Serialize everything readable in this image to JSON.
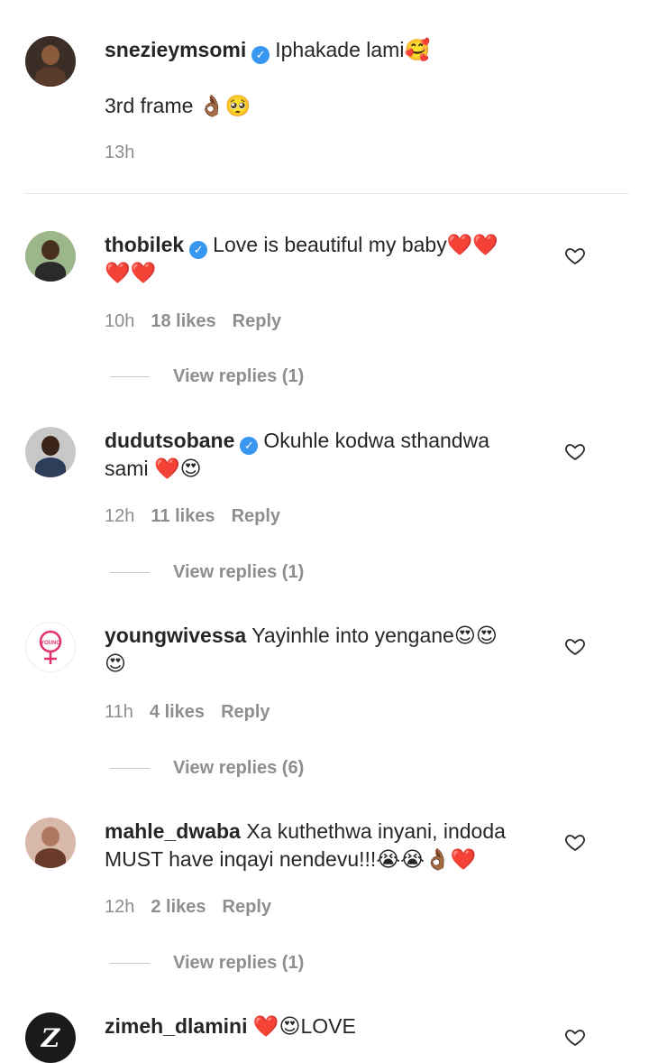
{
  "comments": [
    {
      "username": "snezieymsomi",
      "verified": true,
      "text": "Iphakade lami🥰",
      "text2": "3rd frame 👌🏾🥺",
      "time": "13h",
      "avatar_color": "#3a2e27"
    },
    {
      "username": "thobilek",
      "verified": true,
      "text": "Love is beautiful my baby❤️❤️",
      "text2": "❤️❤️",
      "time": "10h",
      "likes": "18 likes",
      "reply": "Reply",
      "view_replies": "View replies (1)",
      "avatar_color": "#6b8a5c"
    },
    {
      "username": "dudutsobane",
      "verified": true,
      "text": "Okuhle kodwa sthandwa",
      "text2": "sami ❤️😍",
      "time": "12h",
      "likes": "11 likes",
      "reply": "Reply",
      "view_replies": "View replies (1)",
      "avatar_color": "#4a5a6a"
    },
    {
      "username": "youngwivessa",
      "verified": false,
      "text": "Yayinhle into yengane😍😍",
      "text2": "😍",
      "time": "11h",
      "likes": "4 likes",
      "reply": "Reply",
      "view_replies": "View replies (6)",
      "avatar_color": "#ffffff",
      "logo_text": "YOUNG"
    },
    {
      "username": "mahle_dwaba",
      "verified": false,
      "text": "Xa kuthethwa inyani, indoda",
      "text2": "MUST have inqayi nendevu!!!😭😭👌🏾❤️",
      "time": "12h",
      "likes": "2 likes",
      "reply": "Reply",
      "view_replies": "View replies (1)",
      "avatar_color": "#c9a08a"
    },
    {
      "username": "zimeh_dlamini",
      "verified": false,
      "text": "❤️😍LOVE",
      "avatar_color": "#1a1a1a",
      "logo_text": "Z"
    }
  ],
  "icons": {
    "verified": "verified-badge-icon",
    "heart": "heart-outline-icon"
  },
  "colors": {
    "verified": "#3897f0",
    "meta": "#8e8e8e",
    "text": "#262626"
  }
}
